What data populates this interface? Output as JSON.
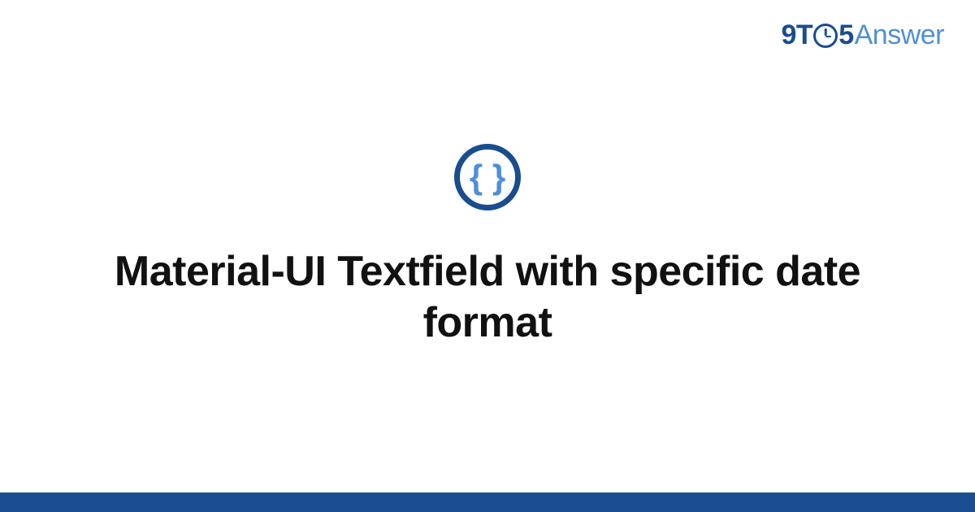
{
  "header": {
    "logo": {
      "prefix": "9T",
      "middle": "5",
      "suffix": "Answer"
    }
  },
  "content": {
    "icon": {
      "braces": "{ }",
      "name": "code-braces-icon"
    },
    "title": "Material-UI Textfield with specific date format"
  },
  "colors": {
    "dark_blue": "#1a4d8f",
    "light_blue": "#4f8fd6",
    "text": "#111111"
  }
}
